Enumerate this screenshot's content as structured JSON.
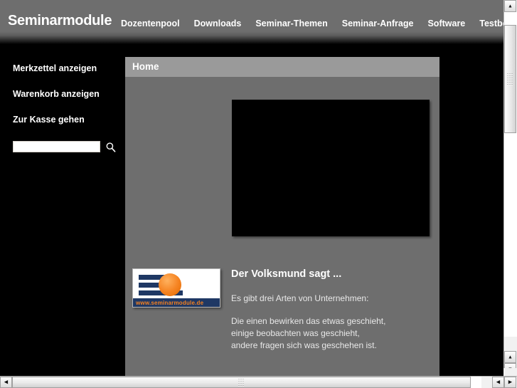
{
  "header": {
    "brand": "Seminarmodule",
    "nav": [
      {
        "label": "Dozentenpool"
      },
      {
        "label": "Downloads"
      },
      {
        "label": "Seminar-Themen"
      },
      {
        "label": "Seminar-Anfrage"
      },
      {
        "label": "Software"
      },
      {
        "label": "Testberichte"
      }
    ]
  },
  "sidebar": {
    "links": [
      {
        "label": "Merkzettel anzeigen"
      },
      {
        "label": "Warenkorb anzeigen"
      },
      {
        "label": "Zur Kasse gehen"
      }
    ],
    "search": {
      "value": "",
      "placeholder": "",
      "icon": "search-icon"
    }
  },
  "content": {
    "page_title": "Home",
    "media": {
      "type": "video-placeholder",
      "color": "#000000"
    },
    "logo": {
      "url_text": "www.seminarmodule.de",
      "bar_color": "#1f3864",
      "accent_color": "#f58220"
    },
    "quote": {
      "heading": "Der Volksmund sagt ...",
      "intro": "Es gibt drei Arten von Unternehmen:",
      "lines": [
        "Die einen bewirken das etwas geschieht,",
        "einige beobachten was geschieht,",
        "andere fragen sich was geschehen ist."
      ]
    }
  },
  "scrollbars": {
    "vertical": {
      "up_glyph": "▲",
      "down_glyph": "▼"
    },
    "horizontal": {
      "left_glyph": "◀",
      "right_glyph": "▶"
    }
  },
  "colors": {
    "header_gray": "#6e6e6e",
    "content_gray": "#6e6e6e",
    "title_bar_gray": "#9a9a9a",
    "page_black": "#000000",
    "text_white": "#ffffff"
  }
}
